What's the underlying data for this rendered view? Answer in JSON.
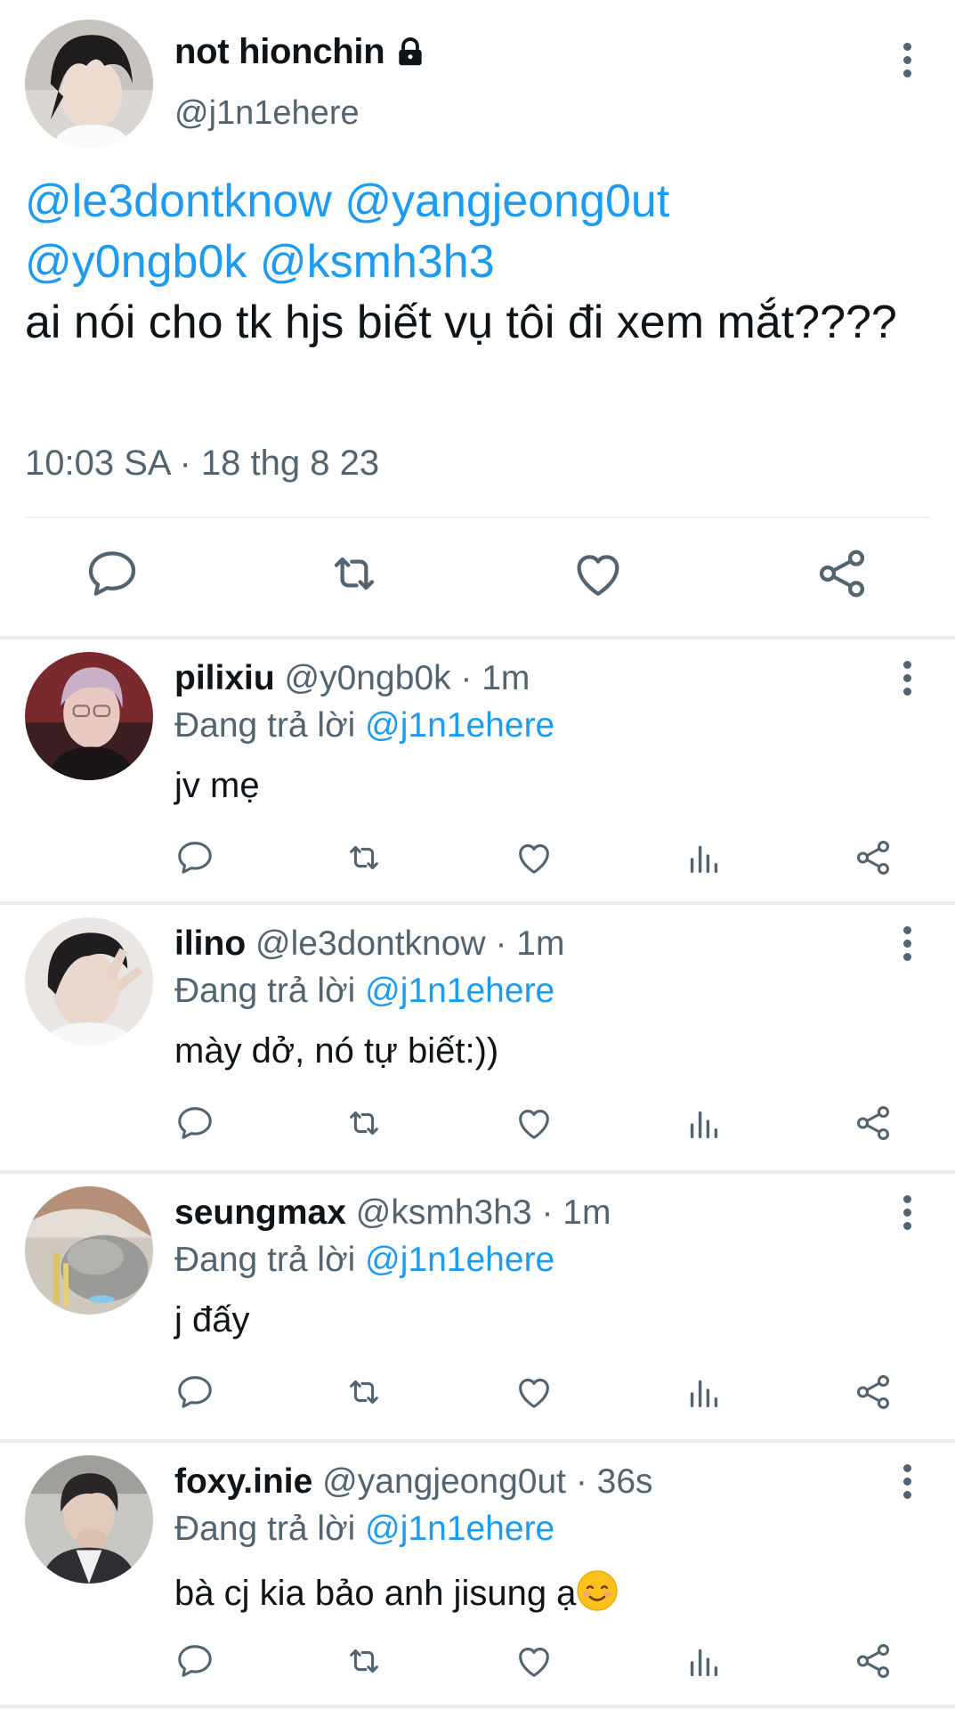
{
  "main_tweet": {
    "display_name": "not hionchin",
    "handle": "@j1n1ehere",
    "mentions_line1": [
      "@le3dontknow",
      "@yangjeong0ut"
    ],
    "mentions_line2": [
      "@y0ngb0k",
      "@ksmh3h3"
    ],
    "text": "ai nói cho tk hjs biết vụ tôi đi xem mắt????",
    "timestamp": "10:03 SA · 18 thg 8 23"
  },
  "replies": [
    {
      "display_name": "pilixiu",
      "handle": "@y0ngb0k",
      "time": "· 1m",
      "replying_label": "Đang trả lời",
      "replying_to": "@j1n1ehere",
      "text": "jv mẹ"
    },
    {
      "display_name": "ilino",
      "handle": "@le3dontknow",
      "time": "· 1m",
      "replying_label": "Đang trả lời",
      "replying_to": "@j1n1ehere",
      "text": "mày dở, nó tự biết:))"
    },
    {
      "display_name": "seungmax",
      "handle": "@ksmh3h3",
      "time": "· 1m",
      "replying_label": "Đang trả lời",
      "replying_to": "@j1n1ehere",
      "text": "j đấy"
    },
    {
      "display_name": "foxy.inie",
      "handle": "@yangjeong0ut",
      "time": "· 36s",
      "replying_label": "Đang trả lời",
      "replying_to": "@j1n1ehere",
      "text": "bà cj kia bảo anh jisung ạ",
      "emoji": "smiling-face-emoji"
    }
  ],
  "colors": {
    "accent": "#1d9bf0",
    "secondary_text": "#536471",
    "primary_text": "#0f1419",
    "divider": "#e6ecf0"
  },
  "icons": [
    "lock-icon",
    "more-icon",
    "reply-icon",
    "retweet-icon",
    "like-icon",
    "views-icon",
    "share-icon"
  ]
}
